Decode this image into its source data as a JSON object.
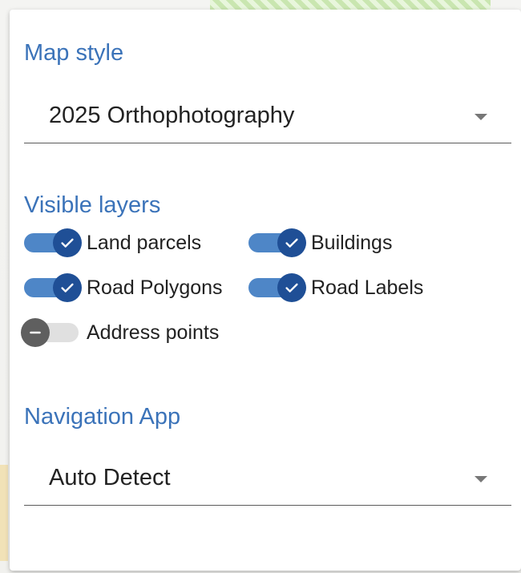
{
  "map_style": {
    "title": "Map style",
    "selected": "2025 Orthophotography"
  },
  "visible_layers": {
    "title": "Visible layers",
    "items": [
      {
        "label": "Land parcels",
        "on": true
      },
      {
        "label": "Buildings",
        "on": true
      },
      {
        "label": "Road Polygons",
        "on": true
      },
      {
        "label": "Road Labels",
        "on": true
      },
      {
        "label": "Address points",
        "on": false
      }
    ]
  },
  "navigation_app": {
    "title": "Navigation App",
    "selected": "Auto Detect"
  },
  "colors": {
    "accent": "#3b73b9",
    "toggle_track_on": "#4e86c7",
    "toggle_thumb_on": "#1f4f96",
    "toggle_thumb_off": "#5f5f5f"
  }
}
